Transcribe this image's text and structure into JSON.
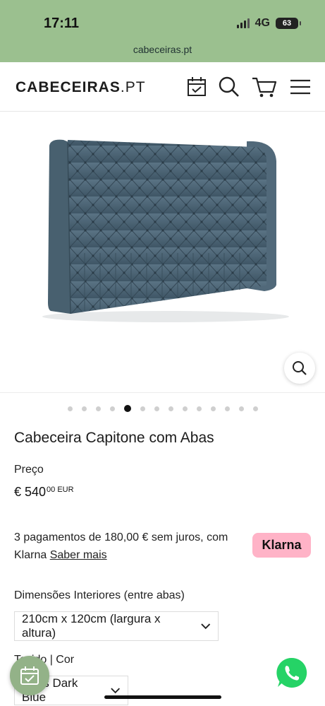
{
  "status": {
    "time": "17:11",
    "network": "4G",
    "battery": "63"
  },
  "browser": {
    "url": "cabeceiras.pt"
  },
  "header": {
    "logo_bold": "CABECEIRAS",
    "logo_light": ".PT"
  },
  "icons": {
    "calendar": "calendar-check-icon",
    "search": "search-icon",
    "cart": "cart-icon",
    "menu": "hamburger-menu-icon",
    "zoom": "zoom-icon",
    "whatsapp": "whatsapp-icon"
  },
  "gallery": {
    "total_dots": 14,
    "active_index": 4
  },
  "product": {
    "title": "Cabeceira Capitone com Abas",
    "price_label": "Preço",
    "price_main": "€ 540",
    "price_cents": "00 EUR"
  },
  "klarna": {
    "text": "3 pagamentos de 180,00 € sem juros, com Klarna ",
    "link": "Saber mais",
    "badge": "Klarna"
  },
  "options": {
    "dimensions_label": "Dimensões Interiores (entre abas)",
    "dimensions_value": "210cm x 120cm (largura x altura)",
    "color_label": "Tecido | Cor",
    "color_value": "Paris Dark Blue"
  },
  "colors": {
    "top_bar": "#9bc08f",
    "fab": "#93b288",
    "klarna": "#ffb3c7",
    "whatsapp": "#25d366",
    "headboard": "#4d6677"
  }
}
